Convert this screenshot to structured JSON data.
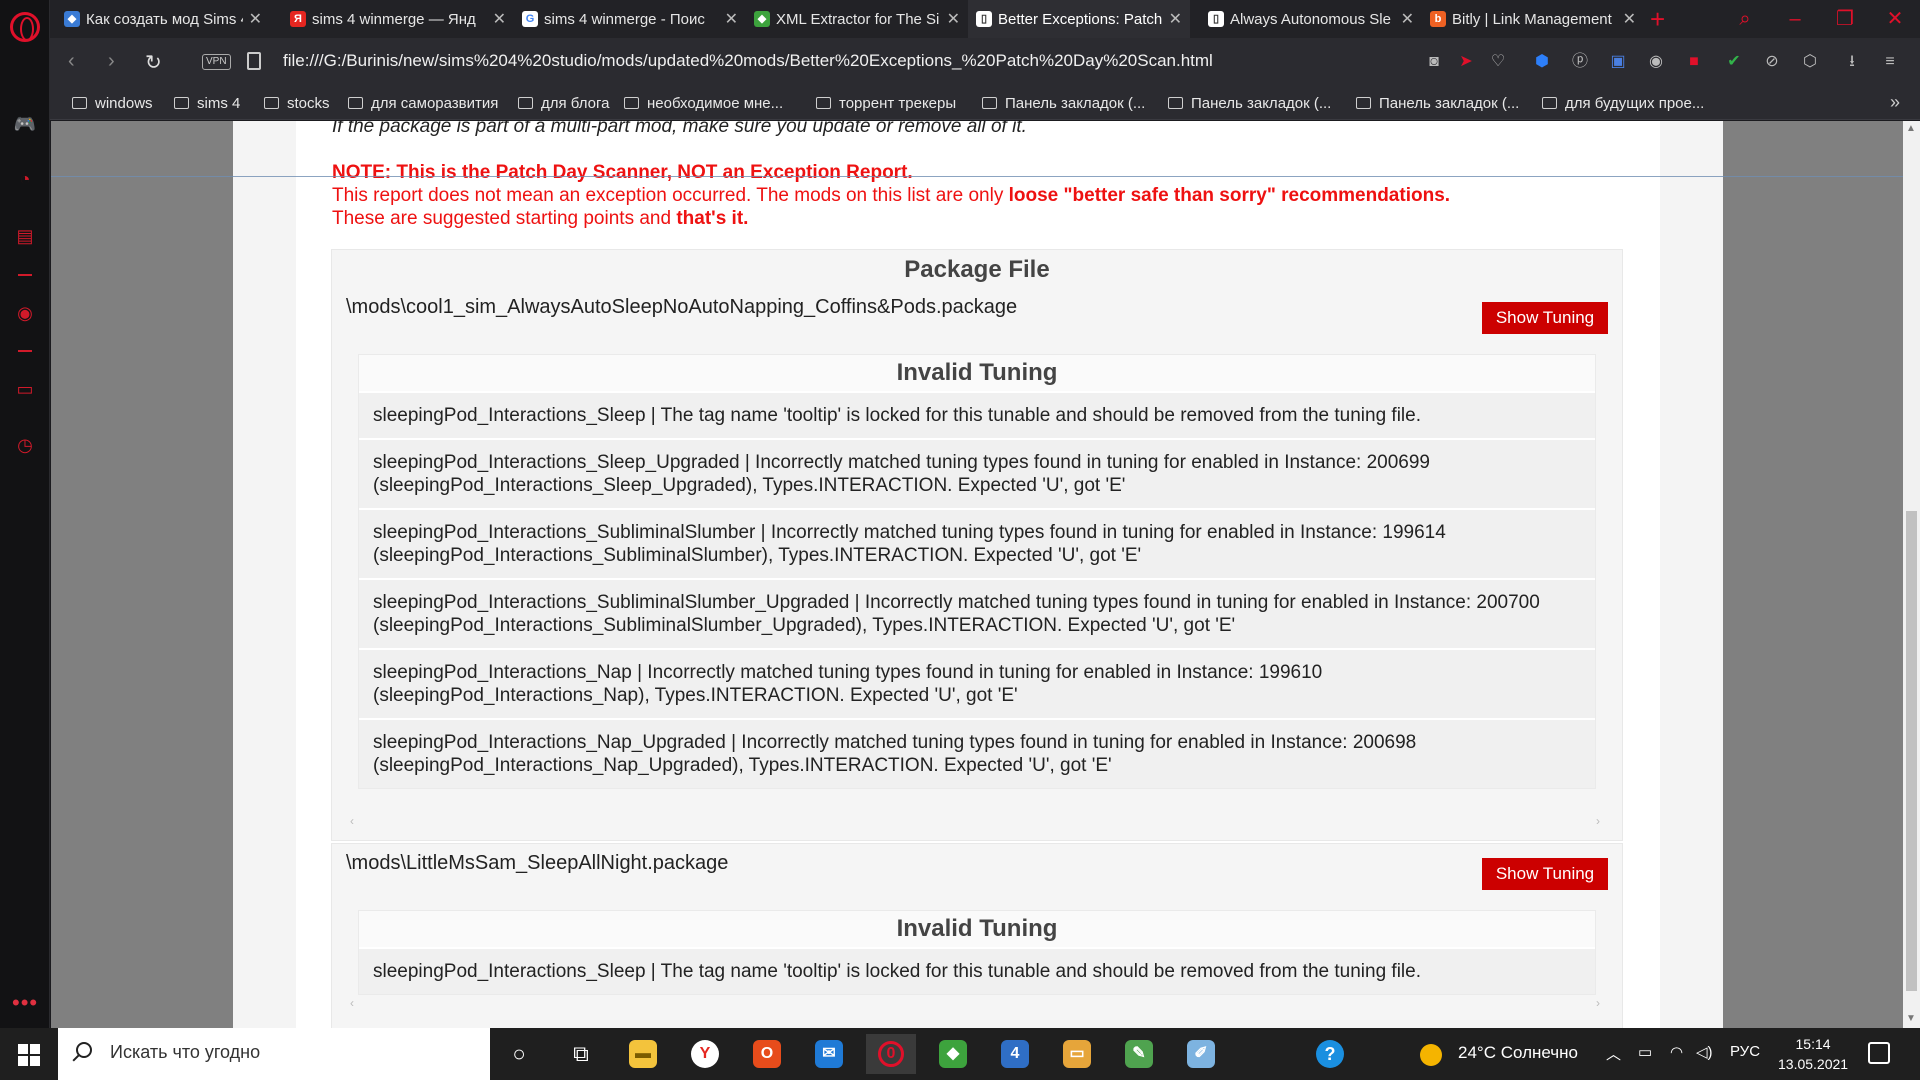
{
  "tabs": [
    {
      "title": "Как создать мод Sims 4",
      "favicon": "sims",
      "active": false
    },
    {
      "title": "sims 4 winmerge — Янд",
      "favicon": "yandex",
      "active": false
    },
    {
      "title": "sims 4 winmerge - Поис",
      "favicon": "google",
      "active": false
    },
    {
      "title": "XML Extractor for The Si",
      "favicon": "sims",
      "active": false
    },
    {
      "title": "Better Exceptions: Patch",
      "favicon": "page",
      "active": true
    },
    {
      "title": "Always Autonomous Sle",
      "favicon": "page",
      "active": false
    },
    {
      "title": "Bitly | Link Management",
      "favicon": "bitly",
      "active": false
    }
  ],
  "address": {
    "vpn": "VPN",
    "url": "file:///G:/Burinis/new/sims%204%20studio/mods/updated%20mods/Better%20Exceptions_%20Patch%20Day%20Scan.html"
  },
  "bookmarks": [
    "windows",
    "sims 4",
    "stocks",
    "для саморазвития",
    "для блога",
    "необходимое мне...",
    "торрент трекеры",
    "Панель закладок (...",
    "Панель закладок (...",
    "Панель закладок (...",
    "для будущих прое..."
  ],
  "report": {
    "cut_line": "If the package is part of a multi-part mod, make sure you update or remove all of it.",
    "note_heading": "NOTE: This is the Patch Day Scanner, NOT an Exception Report.",
    "note_line1_prefix": "This report does not mean an exception occurred. The mods on this list are only ",
    "note_line1_bold": "loose \"better safe than sorry\" recommendations.",
    "note_line2_prefix": "These are suggested starting points and ",
    "note_line2_bold": "that's it.",
    "package_file_header": "Package File",
    "show_tuning_label": "Show Tuning",
    "invalid_tuning_title": "Invalid Tuning",
    "packages": [
      {
        "path": "\\mods\\cool1_sim_AlwaysAutoSleepNoAutoNapping_Coffins&Pods.package",
        "issues": [
          "sleepingPod_Interactions_Sleep | The tag name 'tooltip' is locked for this tunable and should be removed from the tuning file.",
          "sleepingPod_Interactions_Sleep_Upgraded | Incorrectly matched tuning types found in tuning for enabled in Instance: 200699 (sleepingPod_Interactions_Sleep_Upgraded), Types.INTERACTION. Expected 'U', got 'E'",
          "sleepingPod_Interactions_SubliminalSlumber | Incorrectly matched tuning types found in tuning for enabled in Instance: 199614 (sleepingPod_Interactions_SubliminalSlumber), Types.INTERACTION. Expected 'U', got 'E'",
          "sleepingPod_Interactions_SubliminalSlumber_Upgraded | Incorrectly matched tuning types found in tuning for enabled in Instance: 200700 (sleepingPod_Interactions_SubliminalSlumber_Upgraded), Types.INTERACTION. Expected 'U', got 'E'",
          "sleepingPod_Interactions_Nap | Incorrectly matched tuning types found in tuning for enabled in Instance: 199610 (sleepingPod_Interactions_Nap), Types.INTERACTION. Expected 'U', got 'E'",
          "sleepingPod_Interactions_Nap_Upgraded | Incorrectly matched tuning types found in tuning for enabled in Instance: 200698 (sleepingPod_Interactions_Nap_Upgraded), Types.INTERACTION. Expected 'U', got 'E'"
        ]
      },
      {
        "path": "\\mods\\LittleMsSam_SleepAllNight.package",
        "issues": [
          "sleepingPod_Interactions_Sleep | The tag name 'tooltip' is locked for this tunable and should be removed from the tuning file."
        ]
      }
    ]
  },
  "taskbar": {
    "search_placeholder": "Искать что угодно",
    "weather": "24°C Солнечно",
    "language": "РУС",
    "time": "15:14",
    "date": "13.05.2021"
  },
  "colors": {
    "accent_red": "#cc0000",
    "note_red": "#ee1111",
    "opera_red": "#e0102a"
  }
}
